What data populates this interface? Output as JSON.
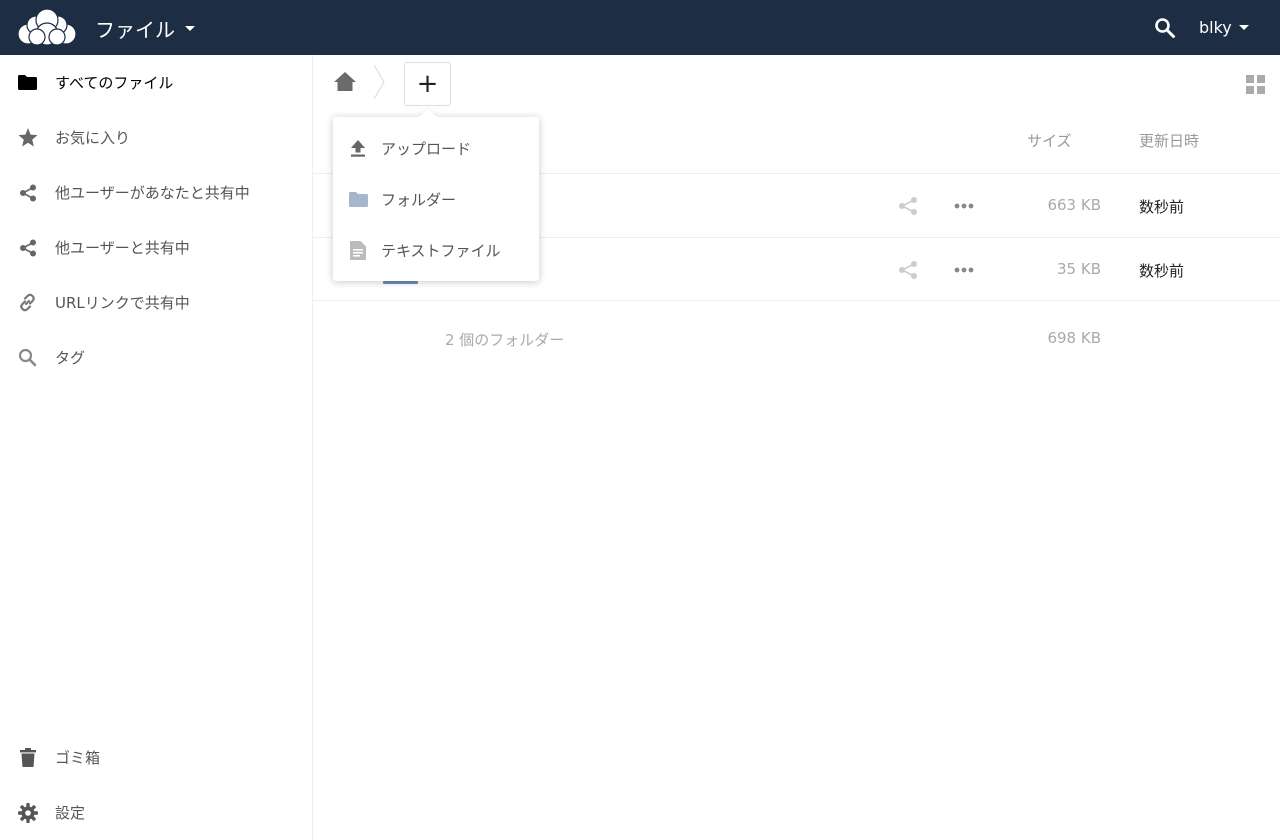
{
  "header": {
    "app_title": "ファイル",
    "user_name": "blky",
    "colors": {
      "background": "#1d2d44",
      "text": "#ffffff"
    },
    "icons": [
      "cloud-logo-icon",
      "search-icon",
      "chevron-down-icon"
    ]
  },
  "sidebar": {
    "items": [
      {
        "label": "すべてのファイル",
        "icon": "folder-icon",
        "active": true
      },
      {
        "label": "お気に入り",
        "icon": "star-icon"
      },
      {
        "label": "他ユーザーがあなたと共有中",
        "icon": "share-icon"
      },
      {
        "label": "他ユーザーと共有中",
        "icon": "share-icon"
      },
      {
        "label": "URLリンクで共有中",
        "icon": "link-icon"
      },
      {
        "label": "タグ",
        "icon": "search-icon"
      }
    ],
    "footer": [
      {
        "label": "ゴミ箱",
        "icon": "trash-icon"
      },
      {
        "label": "設定",
        "icon": "gear-icon"
      }
    ]
  },
  "controls": {
    "new_button_label": "+",
    "icons": [
      "home-icon",
      "grid-view-icon"
    ]
  },
  "new_menu": {
    "items": [
      {
        "label": "アップロード",
        "icon": "upload-icon"
      },
      {
        "label": "フォルダー",
        "icon": "folder-icon"
      },
      {
        "label": "テキストファイル",
        "icon": "text-file-icon"
      }
    ]
  },
  "table": {
    "headers": {
      "size": "サイズ",
      "modified": "更新日時"
    },
    "rows": [
      {
        "size": "663 KB",
        "modified": "数秒前"
      },
      {
        "size": "35 KB",
        "modified": "数秒前"
      }
    ],
    "summary": {
      "count": "2 個のフォルダー",
      "size": "698 KB"
    }
  }
}
